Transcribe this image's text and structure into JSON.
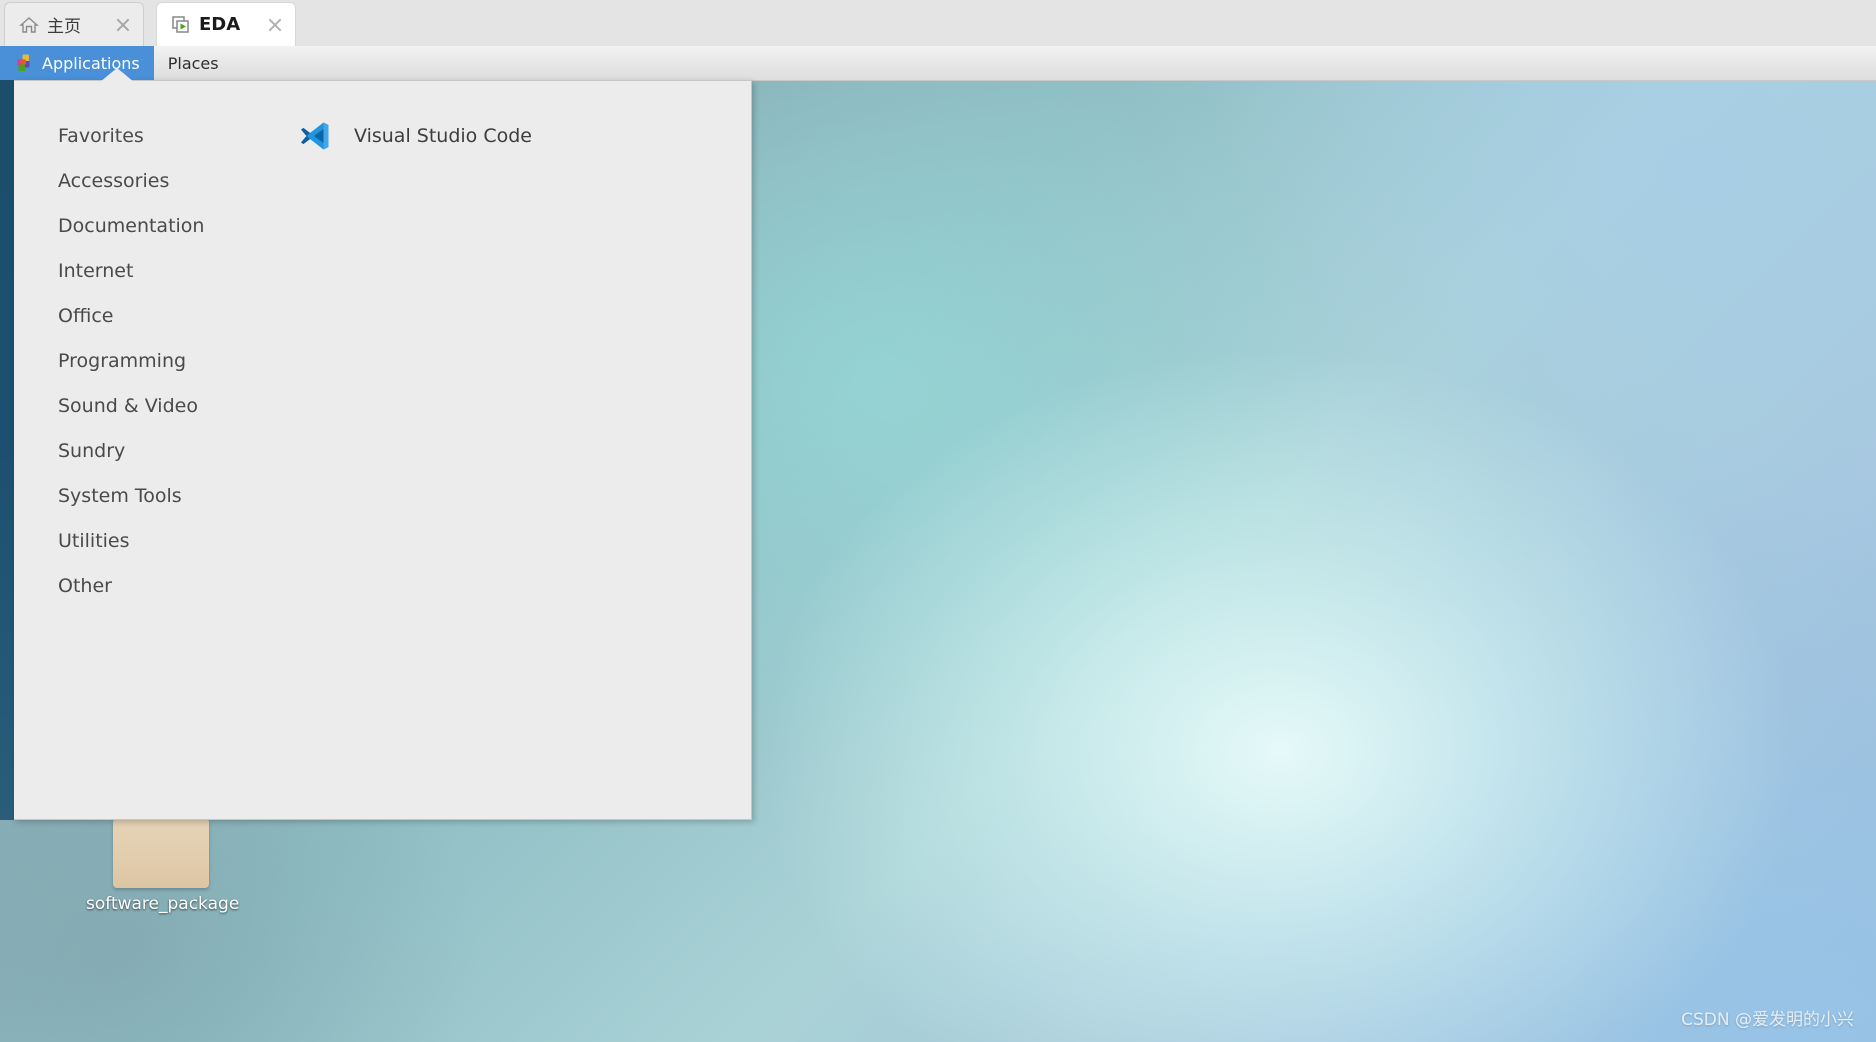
{
  "tabs": [
    {
      "title": "主页",
      "icon": "home-icon",
      "active": false,
      "close_label": "×"
    },
    {
      "title": "EDA",
      "icon": "windows-play-icon",
      "active": true,
      "close_label": "×"
    }
  ],
  "panel": {
    "applications": {
      "label": "Applications",
      "icon": "puzzle-pieces-icon",
      "selected": true
    },
    "places": {
      "label": "Places",
      "selected": false
    }
  },
  "app_menu": {
    "categories": [
      {
        "label": "Favorites"
      },
      {
        "label": "Accessories"
      },
      {
        "label": "Documentation"
      },
      {
        "label": "Internet"
      },
      {
        "label": "Office"
      },
      {
        "label": "Programming"
      },
      {
        "label": "Sound & Video"
      },
      {
        "label": "Sundry"
      },
      {
        "label": "System Tools"
      },
      {
        "label": "Utilities"
      },
      {
        "label": "Other"
      }
    ],
    "applications": [
      {
        "label": "Visual Studio Code",
        "icon": "vscode-icon"
      }
    ]
  },
  "desktop": {
    "icons": [
      {
        "label": "software_package",
        "icon": "folder-icon"
      }
    ]
  },
  "watermark": {
    "text": "CSDN @爱发明的小兴"
  },
  "colors": {
    "panel_selected": "#4a90d9",
    "menu_background": "#ececec",
    "menu_rail": "#1d5070",
    "vscode_blue": "#2196de",
    "folder_tan": "#e2cdae"
  }
}
